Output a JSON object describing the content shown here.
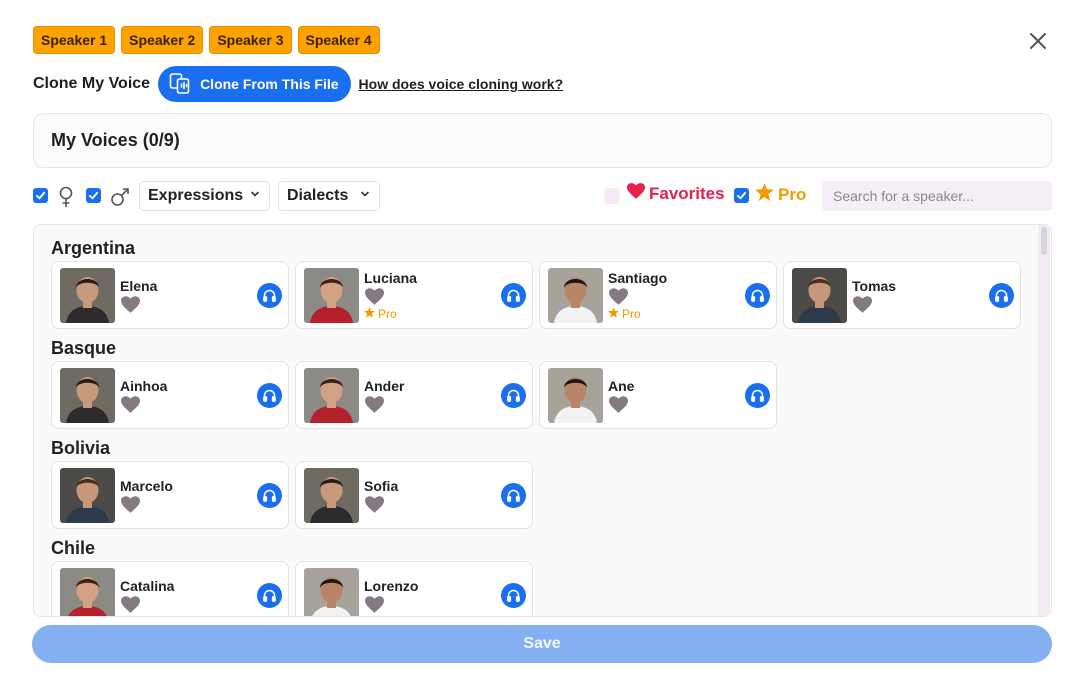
{
  "speaker_tabs": [
    "Speaker 1",
    "Speaker 2",
    "Speaker 3",
    "Speaker 4"
  ],
  "clone": {
    "label": "Clone My Voice",
    "button": "Clone From This File",
    "help_link": "How does voice cloning work?"
  },
  "my_voices": "My Voices (0/9)",
  "filters": {
    "female_checked": true,
    "male_checked": true,
    "expressions": "Expressions",
    "dialects": "Dialects",
    "favorites": "Favorites",
    "favorites_checked": false,
    "pro": "Pro",
    "pro_checked": true,
    "search_placeholder": "Search for a speaker..."
  },
  "groups": [
    {
      "title": "Argentina",
      "speakers": [
        {
          "name": "Elena",
          "pro": false
        },
        {
          "name": "Luciana",
          "pro": true,
          "pro_label": "Pro"
        },
        {
          "name": "Santiago",
          "pro": true,
          "pro_label": "Pro"
        },
        {
          "name": "Tomas",
          "pro": false
        }
      ]
    },
    {
      "title": "Basque",
      "speakers": [
        {
          "name": "Ainhoa",
          "pro": false
        },
        {
          "name": "Ander",
          "pro": false
        },
        {
          "name": "Ane",
          "pro": false
        }
      ]
    },
    {
      "title": "Bolivia",
      "speakers": [
        {
          "name": "Marcelo",
          "pro": false
        },
        {
          "name": "Sofia",
          "pro": false
        }
      ]
    },
    {
      "title": "Chile",
      "speakers": [
        {
          "name": "Catalina",
          "pro": false
        },
        {
          "name": "Lorenzo",
          "pro": false
        }
      ]
    }
  ],
  "save": "Save",
  "colors": {
    "accent": "#1a6ef0",
    "speaker_tab": "#ffa200",
    "favorites": "#e8204d",
    "pro": "#f39a00",
    "save_disabled": "#85b1f2"
  },
  "icons": {
    "close": "close-icon",
    "clone": "voice-clone-icon",
    "female": "female-icon",
    "male": "male-icon",
    "chevron": "chevron-down-icon",
    "favorite": "heart-icon",
    "pro": "star-icon",
    "play": "headphones-icon"
  }
}
